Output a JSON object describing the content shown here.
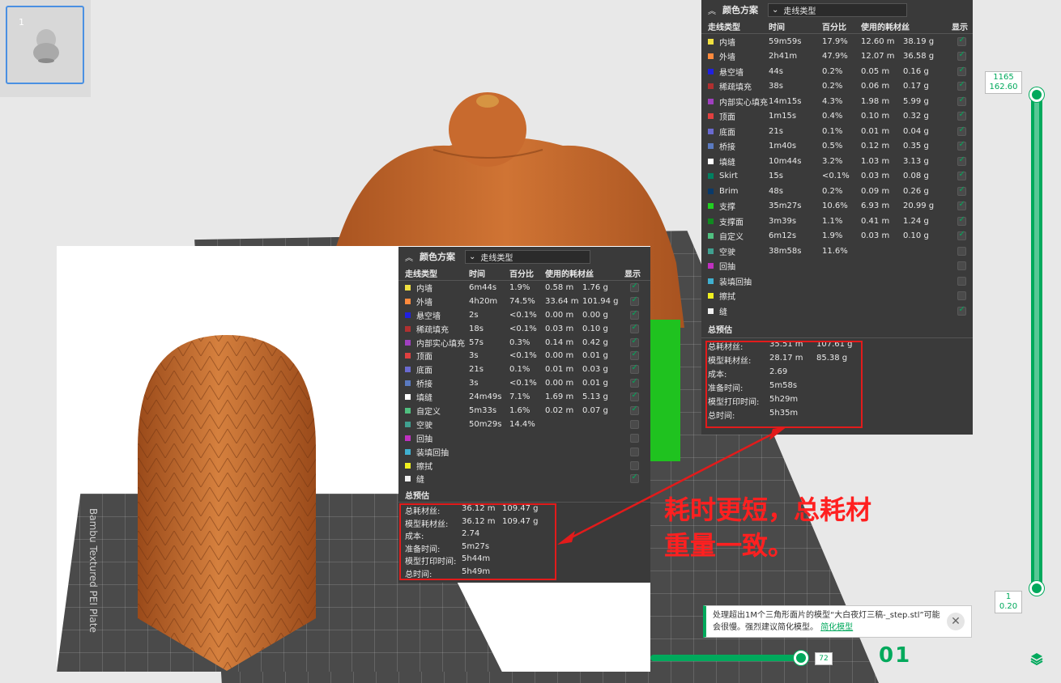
{
  "plate_thumbnail": {
    "number": "1"
  },
  "plate_label": "Bambu Textured PEI Plate",
  "annotation": {
    "line1": "耗时更短，总耗材",
    "line2": "重量一致。"
  },
  "layer_slider": {
    "top_layer": "1165",
    "top_height": "162.60",
    "bottom_layer": "1",
    "bottom_height": "0.20"
  },
  "move_slider": {
    "value": "72"
  },
  "plate_index": "01",
  "notice": {
    "text": "处理超出1M个三角形面片的模型“大白夜灯三稿-_step.stl”可能会很慢。强烈建议简化模型。",
    "link": "简化模型"
  },
  "colors": {
    "accent": "#00a95c",
    "panel_bg": "#3a3a3a",
    "model": "#c86a2e",
    "highlight": "#e21b1b"
  },
  "panel_right": {
    "title": "颜色方案",
    "scheme": "走线类型",
    "headers": [
      "走线类型",
      "时间",
      "百分比",
      "使用的耗材丝",
      "显示"
    ],
    "rows": [
      {
        "name": "内墙",
        "color": "#f0e040",
        "time": "59m59s",
        "pct": "17.9%",
        "len": "12.60 m",
        "wt": "38.19 g",
        "on": true
      },
      {
        "name": "外墙",
        "color": "#ff8a3d",
        "time": "2h41m",
        "pct": "47.9%",
        "len": "12.07 m",
        "wt": "36.58 g",
        "on": true
      },
      {
        "name": "悬空墙",
        "color": "#2020e0",
        "time": "44s",
        "pct": "0.2%",
        "len": "0.05 m",
        "wt": "0.16 g",
        "on": true
      },
      {
        "name": "稀疏填充",
        "color": "#b03030",
        "time": "38s",
        "pct": "0.2%",
        "len": "0.06 m",
        "wt": "0.17 g",
        "on": true
      },
      {
        "name": "内部实心填充",
        "color": "#a040c0",
        "time": "14m15s",
        "pct": "4.3%",
        "len": "1.98 m",
        "wt": "5.99 g",
        "on": true
      },
      {
        "name": "顶面",
        "color": "#e04040",
        "time": "1m15s",
        "pct": "0.4%",
        "len": "0.10 m",
        "wt": "0.32 g",
        "on": true
      },
      {
        "name": "底面",
        "color": "#6a6ad0",
        "time": "21s",
        "pct": "0.1%",
        "len": "0.01 m",
        "wt": "0.04 g",
        "on": true
      },
      {
        "name": "桥接",
        "color": "#5a7ac0",
        "time": "1m40s",
        "pct": "0.5%",
        "len": "0.12 m",
        "wt": "0.35 g",
        "on": true
      },
      {
        "name": "填缝",
        "color": "#ffffff",
        "time": "10m44s",
        "pct": "3.2%",
        "len": "1.03 m",
        "wt": "3.13 g",
        "on": true
      },
      {
        "name": "Skirt",
        "color": "#008060",
        "time": "15s",
        "pct": "<0.1%",
        "len": "0.03 m",
        "wt": "0.08 g",
        "on": true
      },
      {
        "name": "Brim",
        "color": "#0a3a6a",
        "time": "48s",
        "pct": "0.2%",
        "len": "0.09 m",
        "wt": "0.26 g",
        "on": true
      },
      {
        "name": "支撑",
        "color": "#20d020",
        "time": "35m27s",
        "pct": "10.6%",
        "len": "6.93 m",
        "wt": "20.99 g",
        "on": true
      },
      {
        "name": "支撑面",
        "color": "#108a20",
        "time": "3m39s",
        "pct": "1.1%",
        "len": "0.41 m",
        "wt": "1.24 g",
        "on": true
      },
      {
        "name": "自定义",
        "color": "#50c080",
        "time": "6m12s",
        "pct": "1.9%",
        "len": "0.03 m",
        "wt": "0.10 g",
        "on": true
      },
      {
        "name": "空驶",
        "color": "#40a090",
        "time": "38m58s",
        "pct": "11.6%",
        "len": "",
        "wt": "",
        "on": false
      },
      {
        "name": "回抽",
        "color": "#c030c0",
        "time": "",
        "pct": "",
        "len": "",
        "wt": "",
        "on": false
      },
      {
        "name": "装填回抽",
        "color": "#40b0d0",
        "time": "",
        "pct": "",
        "len": "",
        "wt": "",
        "on": false
      },
      {
        "name": "擦拭",
        "color": "#f0f020",
        "time": "",
        "pct": "",
        "len": "",
        "wt": "",
        "on": false
      },
      {
        "name": "缝",
        "color": "#f0f0f0",
        "time": "",
        "pct": "",
        "len": "",
        "wt": "",
        "on": true
      }
    ],
    "summary_title": "总预估",
    "summary": [
      {
        "label": "总耗材丝:",
        "v1": "35.51 m",
        "v2": "107.61 g"
      },
      {
        "label": "模型耗材丝:",
        "v1": "28.17 m",
        "v2": "85.38 g"
      },
      {
        "label": "成本:",
        "v1": "2.69",
        "v2": ""
      },
      {
        "label": "准备时间:",
        "v1": "5m58s",
        "v2": ""
      },
      {
        "label": "模型打印时间:",
        "v1": "5h29m",
        "v2": ""
      },
      {
        "label": "总时间:",
        "v1": "5h35m",
        "v2": ""
      }
    ]
  },
  "panel_left": {
    "title": "颜色方案",
    "scheme": "走线类型",
    "headers": [
      "走线类型",
      "时间",
      "百分比",
      "使用的耗材丝",
      "显示"
    ],
    "rows": [
      {
        "name": "内墙",
        "color": "#f0e040",
        "time": "6m44s",
        "pct": "1.9%",
        "len": "0.58 m",
        "wt": "1.76 g",
        "on": true
      },
      {
        "name": "外墙",
        "color": "#ff8a3d",
        "time": "4h20m",
        "pct": "74.5%",
        "len": "33.64 m",
        "wt": "101.94 g",
        "on": true
      },
      {
        "name": "悬空墙",
        "color": "#2020e0",
        "time": "2s",
        "pct": "<0.1%",
        "len": "0.00 m",
        "wt": "0.00 g",
        "on": true
      },
      {
        "name": "稀疏填充",
        "color": "#b03030",
        "time": "18s",
        "pct": "<0.1%",
        "len": "0.03 m",
        "wt": "0.10 g",
        "on": true
      },
      {
        "name": "内部实心填充",
        "color": "#a040c0",
        "time": "57s",
        "pct": "0.3%",
        "len": "0.14 m",
        "wt": "0.42 g",
        "on": true
      },
      {
        "name": "顶面",
        "color": "#e04040",
        "time": "3s",
        "pct": "<0.1%",
        "len": "0.00 m",
        "wt": "0.01 g",
        "on": true
      },
      {
        "name": "底面",
        "color": "#6a6ad0",
        "time": "21s",
        "pct": "0.1%",
        "len": "0.01 m",
        "wt": "0.03 g",
        "on": true
      },
      {
        "name": "桥接",
        "color": "#5a7ac0",
        "time": "3s",
        "pct": "<0.1%",
        "len": "0.00 m",
        "wt": "0.01 g",
        "on": true
      },
      {
        "name": "填缝",
        "color": "#ffffff",
        "time": "24m49s",
        "pct": "7.1%",
        "len": "1.69 m",
        "wt": "5.13 g",
        "on": true
      },
      {
        "name": "自定义",
        "color": "#50c080",
        "time": "5m33s",
        "pct": "1.6%",
        "len": "0.02 m",
        "wt": "0.07 g",
        "on": true
      },
      {
        "name": "空驶",
        "color": "#40a090",
        "time": "50m29s",
        "pct": "14.4%",
        "len": "",
        "wt": "",
        "on": false
      },
      {
        "name": "回抽",
        "color": "#c030c0",
        "time": "",
        "pct": "",
        "len": "",
        "wt": "",
        "on": false
      },
      {
        "name": "装填回抽",
        "color": "#40b0d0",
        "time": "",
        "pct": "",
        "len": "",
        "wt": "",
        "on": false
      },
      {
        "name": "擦拭",
        "color": "#f0f020",
        "time": "",
        "pct": "",
        "len": "",
        "wt": "",
        "on": false
      },
      {
        "name": "缝",
        "color": "#f0f0f0",
        "time": "",
        "pct": "",
        "len": "",
        "wt": "",
        "on": true
      }
    ],
    "summary_title": "总预估",
    "summary": [
      {
        "label": "总耗材丝:",
        "v1": "36.12 m",
        "v2": "109.47 g"
      },
      {
        "label": "模型耗材丝:",
        "v1": "36.12 m",
        "v2": "109.47 g"
      },
      {
        "label": "成本:",
        "v1": "2.74",
        "v2": ""
      },
      {
        "label": "准备时间:",
        "v1": "5m27s",
        "v2": ""
      },
      {
        "label": "模型打印时间:",
        "v1": "5h44m",
        "v2": ""
      },
      {
        "label": "总时间:",
        "v1": "5h49m",
        "v2": ""
      }
    ]
  }
}
